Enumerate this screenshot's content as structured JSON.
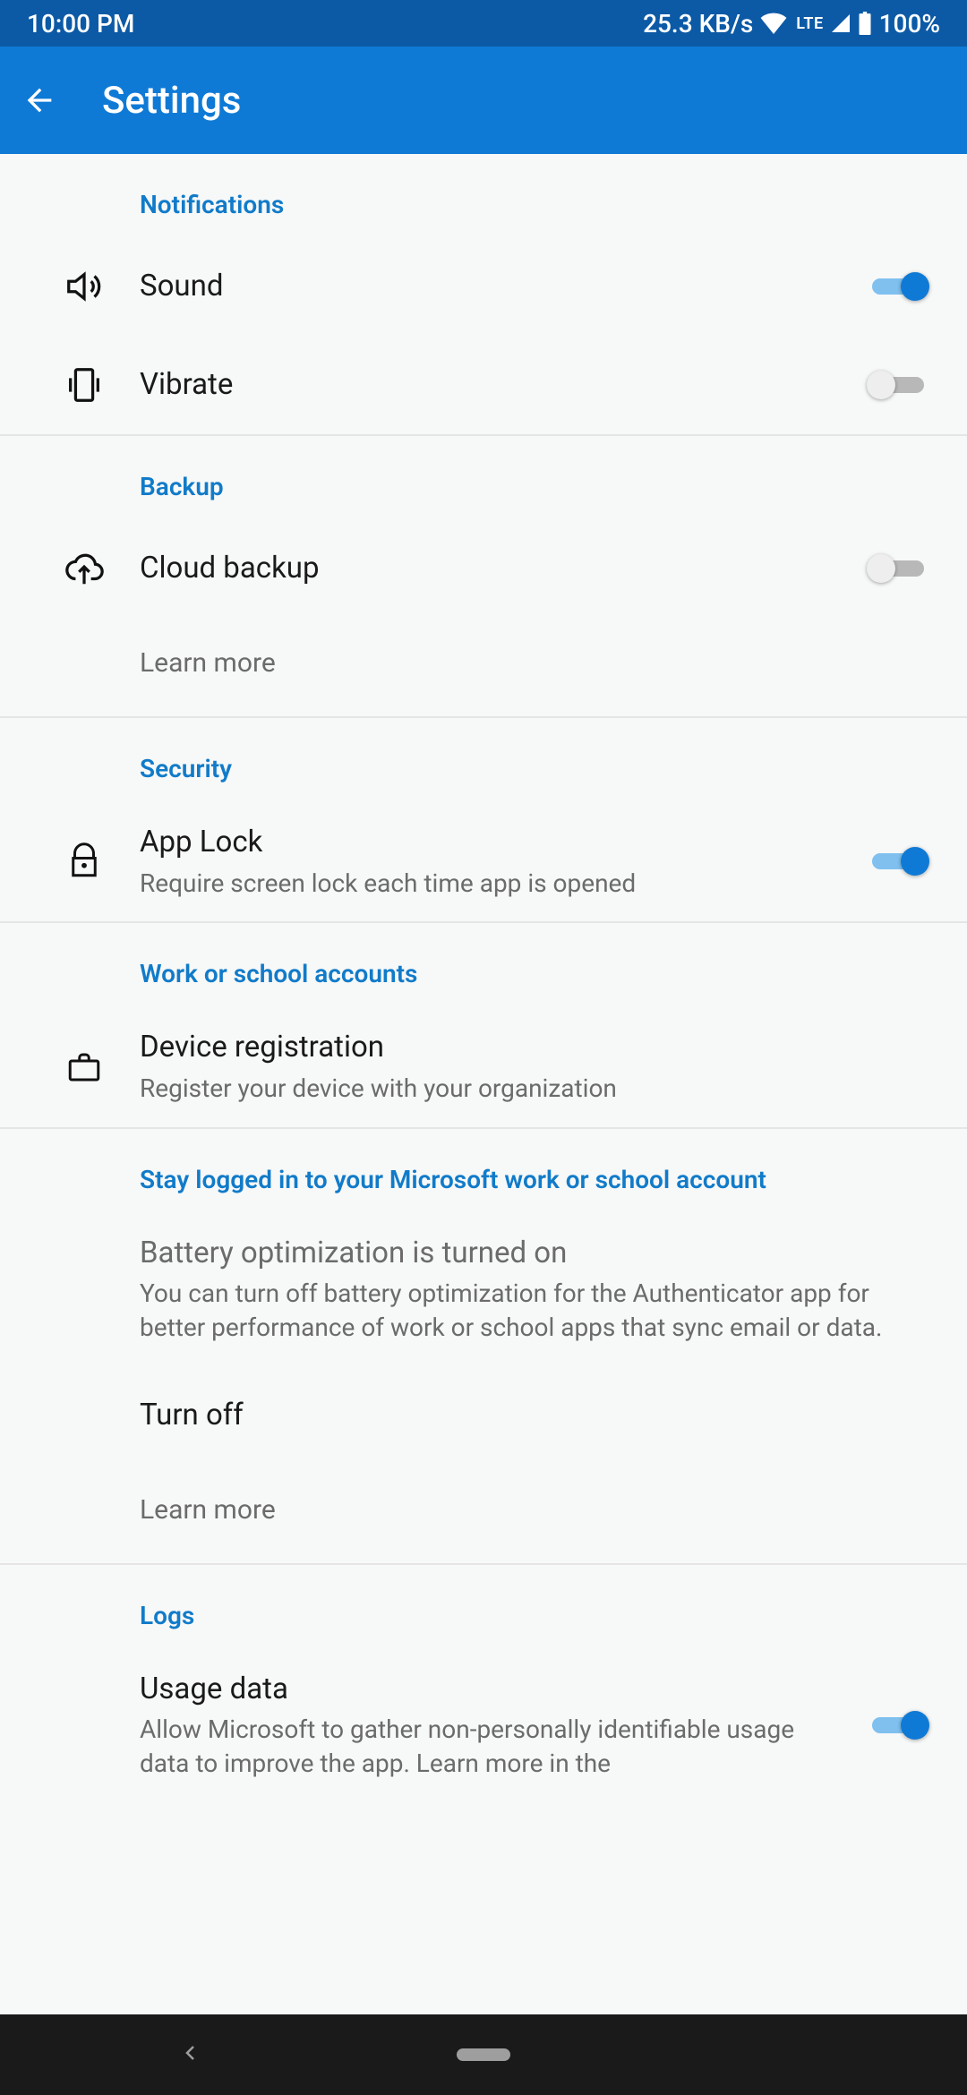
{
  "status": {
    "time": "10:00 PM",
    "net_speed": "25.3 KB/s",
    "lte": "LTE",
    "battery": "100%"
  },
  "header": {
    "title": "Settings"
  },
  "sections": {
    "notifications": {
      "title": "Notifications",
      "sound": {
        "label": "Sound",
        "on": true
      },
      "vibrate": {
        "label": "Vibrate",
        "on": false
      }
    },
    "backup": {
      "title": "Backup",
      "cloud": {
        "label": "Cloud backup",
        "on": false
      },
      "learn_more": "Learn more"
    },
    "security": {
      "title": "Security",
      "applock": {
        "label": "App Lock",
        "sub": "Require screen lock each time app is opened",
        "on": true
      }
    },
    "work": {
      "title": "Work or school accounts",
      "device_reg": {
        "label": "Device registration",
        "sub": "Register your device with your organization"
      }
    },
    "stay": {
      "title": "Stay logged in to your Microsoft work or school account",
      "battery": {
        "label": "Battery optimization is turned on",
        "sub": "You can turn off battery optimization for the Authenticator app for better performance of work or school apps that sync email or data."
      },
      "turn_off": "Turn off",
      "learn_more": "Learn more"
    },
    "logs": {
      "title": "Logs",
      "usage": {
        "label": "Usage data",
        "sub": "Allow Microsoft to gather non-personally identifiable usage data to improve the app. Learn more in the",
        "on": true
      }
    }
  }
}
